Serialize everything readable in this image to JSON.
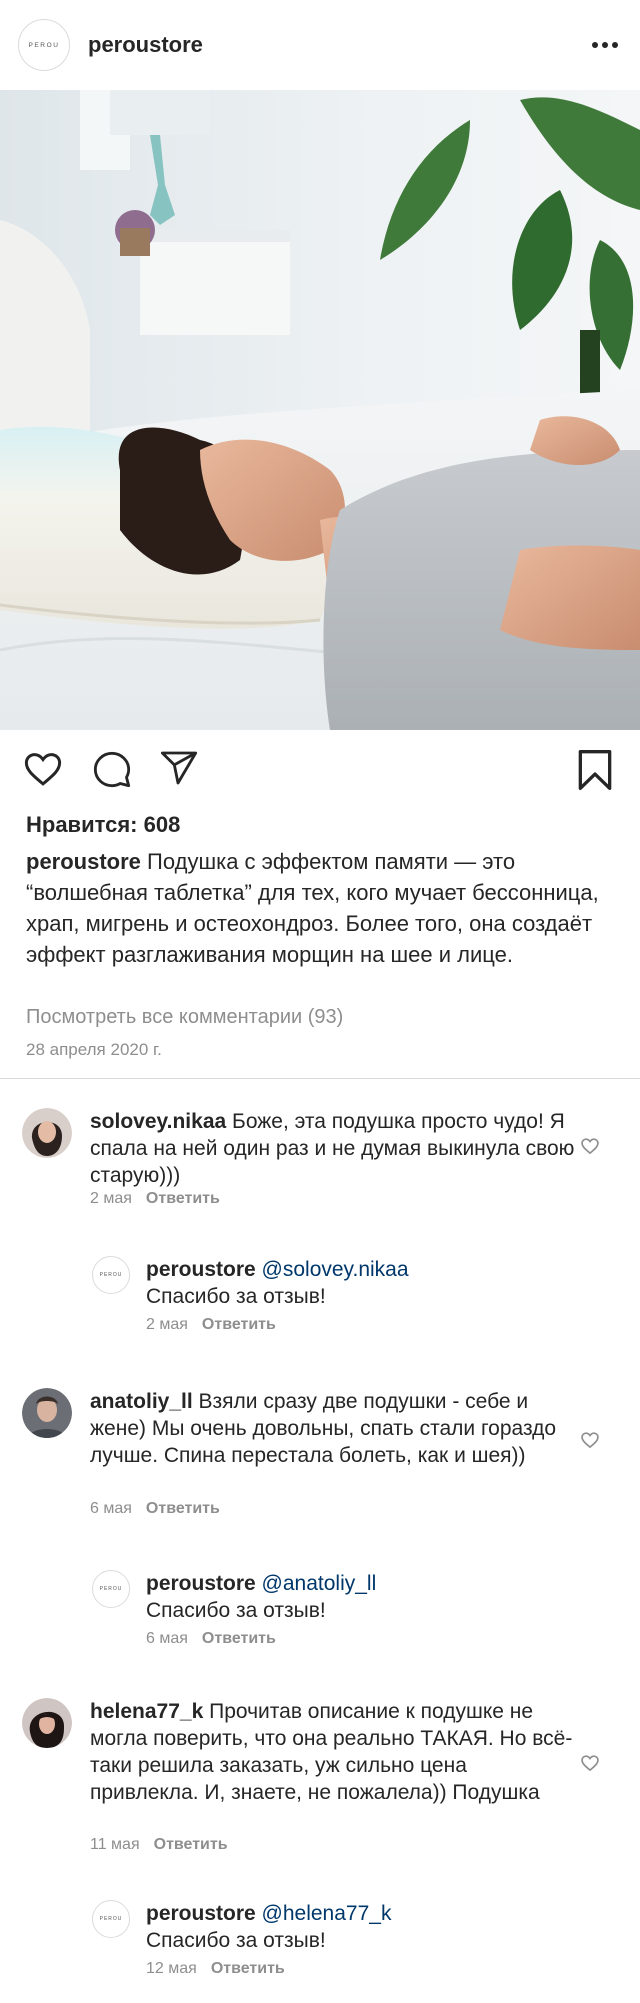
{
  "header": {
    "logo_text": "PEROU",
    "username": "peroustore",
    "more_icon": "more-horizontal-icon"
  },
  "post": {
    "image_alt": "woman sleeping on memory foam pillow",
    "actions": {
      "like_icon": "heart-icon",
      "comment_icon": "comment-icon",
      "share_icon": "send-icon",
      "save_icon": "bookmark-icon"
    },
    "likes_text": "Нравится: 608",
    "caption_user": "peroustore",
    "caption_text": "Подушка с эффектом памяти — это “волшебная таблетка” для тех, кого мучает бессонница, храп, мигрень и остеохондроз. Более того, она создаёт эффект разглаживания морщин на шее и лице.",
    "view_all_comments": "Посмотреть все комментарии (93)",
    "date": "28 апреля 2020 г."
  },
  "comments": [
    {
      "user": "solovey.nikaa",
      "text": "Боже, эта подушка просто чудо! Я спала на ней один раз и не думая выкинула свою старую)))",
      "date": "2 мая",
      "reply_label": "Ответить",
      "reply": {
        "user": "peroustore",
        "mention": "@solovey.nikaa",
        "text": "Спасибо за отзыв!",
        "date": "2 мая",
        "reply_label": "Ответить"
      }
    },
    {
      "user": "anatoliy_ll",
      "text": "Взяли сразу две подушки - себе и жене) Мы очень довольны, спать стали гораздо лучше. Спина перестала болеть, как и шея))",
      "date": "6 мая",
      "reply_label": "Ответить",
      "reply": {
        "user": "peroustore",
        "mention": "@anatoliy_ll",
        "text": "Спасибо за отзыв!",
        "date": "6 мая",
        "reply_label": "Ответить"
      }
    },
    {
      "user": "helena77_k",
      "text": "Прочитав описание к подушке не могла поверить, что она реально ТАКАЯ. Но всё-таки решила заказать, уж сильно цена привлекла. И, знаете, не пожалела)) Подушка",
      "date": "11 мая",
      "reply_label": "Ответить",
      "reply": {
        "user": "peroustore",
        "mention": "@helena77_k",
        "text": "Спасибо за отзыв!",
        "date": "12 мая",
        "reply_label": "Ответить"
      }
    }
  ],
  "colors": {
    "text": "#262626",
    "muted": "#8e8e8e",
    "mention": "#00376b",
    "divider": "#dbdbdb"
  }
}
